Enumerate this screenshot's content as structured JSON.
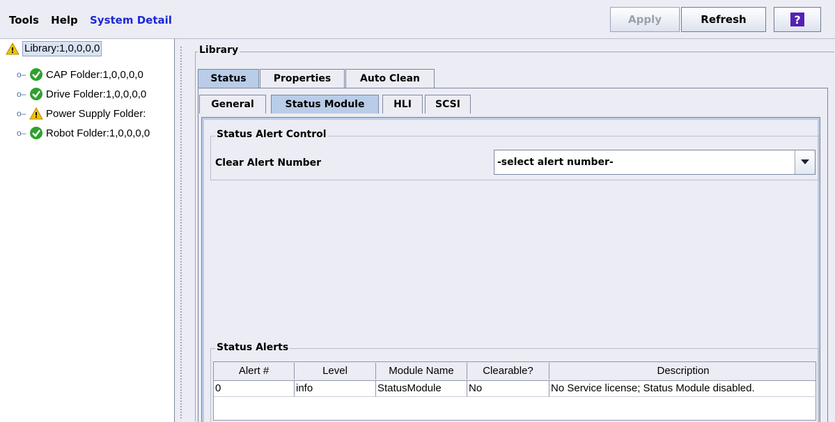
{
  "menu": {
    "tools": "Tools",
    "help": "Help",
    "system_detail": "System Detail"
  },
  "toolbar": {
    "apply": "Apply",
    "refresh": "Refresh",
    "help_glyph": "?"
  },
  "tree": {
    "root": {
      "label": "Library:1,0,0,0,0",
      "icon": "warning-icon"
    },
    "items": [
      {
        "label": "CAP Folder:1,0,0,0,0",
        "icon": "ok-check-icon"
      },
      {
        "label": "Drive Folder:1,0,0,0,0",
        "icon": "ok-check-icon"
      },
      {
        "label": "Power Supply Folder:",
        "icon": "warning-icon"
      },
      {
        "label": "Robot Folder:1,0,0,0,0",
        "icon": "ok-check-icon"
      }
    ]
  },
  "main": {
    "group_title": "Library",
    "tabs": [
      "Status",
      "Properties",
      "Auto Clean"
    ],
    "subtabs": [
      "General",
      "Status Module",
      "HLI",
      "SCSI"
    ],
    "alert_control": {
      "title": "Status Alert Control",
      "label": "Clear Alert Number",
      "select_value": "-select alert number-"
    },
    "alerts": {
      "title": "Status Alerts",
      "columns": [
        "Alert #",
        "Level",
        "Module Name",
        "Clearable?",
        "Description"
      ],
      "rows": [
        [
          "0",
          "info",
          "StatusModule",
          "No",
          "No Service license; Status Module disabled."
        ]
      ]
    }
  },
  "colors": {
    "accent": "#1a28d8",
    "selected_tab": "#b9cde8",
    "help_bg": "#5521b5",
    "warning": "#f2c200",
    "ok": "#2ea12e"
  }
}
